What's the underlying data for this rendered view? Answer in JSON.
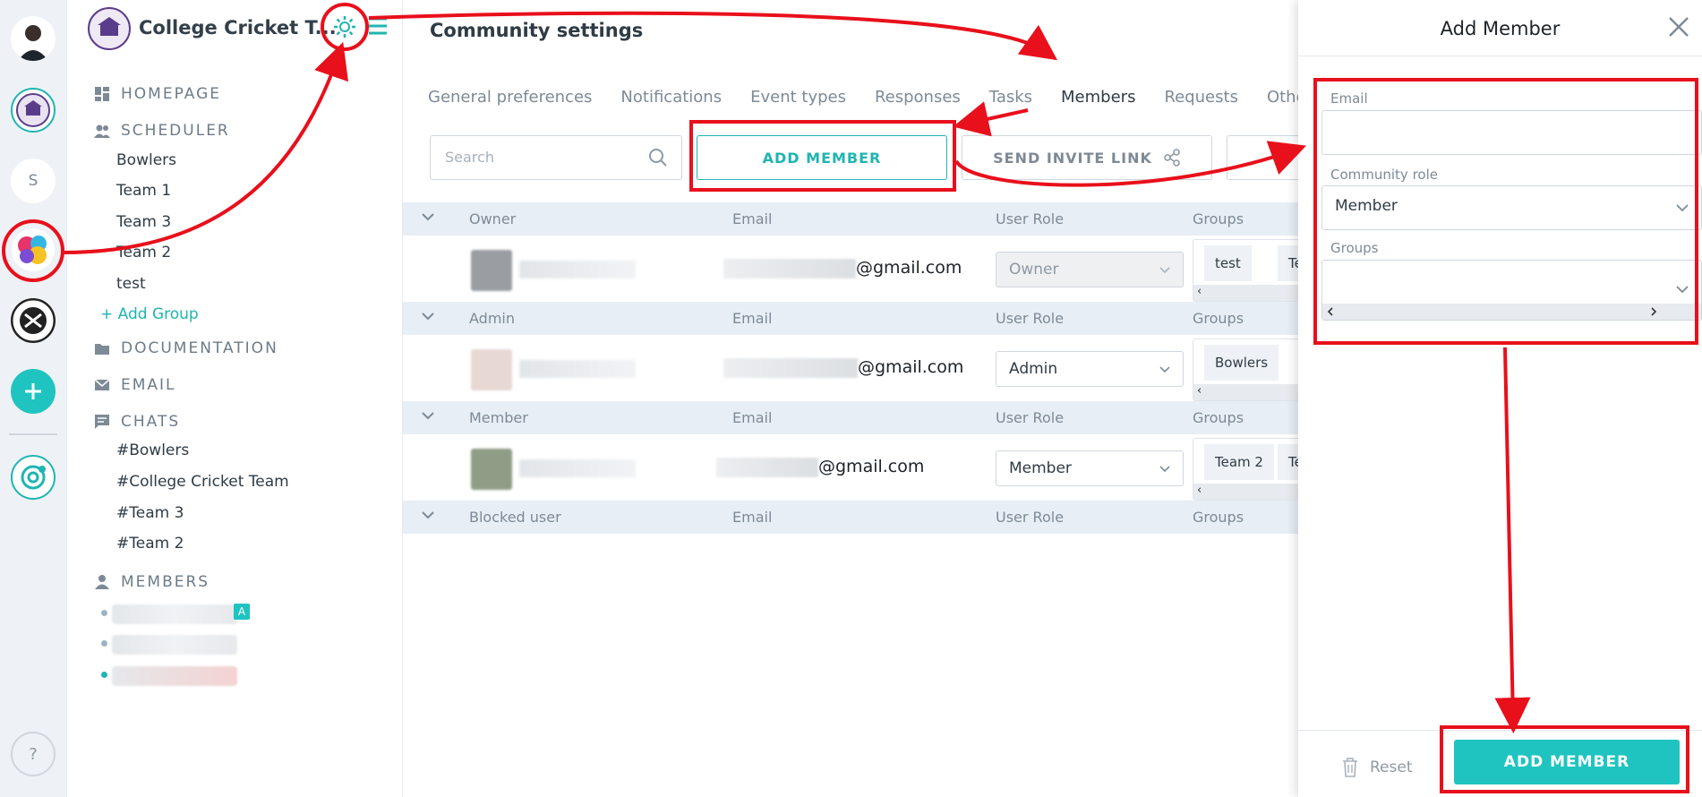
{
  "rail": {
    "items": [
      {
        "name": "user-avatar",
        "initial": ""
      },
      {
        "name": "university-community",
        "initial": ""
      },
      {
        "name": "community-s",
        "initial": "S"
      },
      {
        "name": "colorful-community",
        "initial": ""
      },
      {
        "name": "mining-community",
        "initial": ""
      }
    ],
    "help_label": "?"
  },
  "sidebar": {
    "title": "College Cricket T...",
    "sections": {
      "homepage": "HOMEPAGE",
      "scheduler": "SCHEDULER",
      "documentation": "DOCUMENTATION",
      "email": "EMAIL",
      "chats": "CHATS",
      "members": "MEMBERS"
    },
    "scheduler_items": [
      "Bowlers",
      "Team 1",
      "Team 3",
      "Team 2",
      "test"
    ],
    "add_group": "+ Add Group",
    "chat_items": [
      "#Bowlers",
      "#College Cricket Team",
      "#Team 3",
      "#Team 2"
    ],
    "admin_badge": "A"
  },
  "main": {
    "title": "Community settings",
    "tabs": [
      "General preferences",
      "Notifications",
      "Event types",
      "Responses",
      "Tasks",
      "Members",
      "Requests",
      "Other"
    ],
    "active_tab": "Members",
    "search_placeholder": "Search",
    "add_member_label": "ADD MEMBER",
    "send_invite_label": "SEND INVITE LINK",
    "columns": {
      "email": "Email",
      "user_role": "User Role",
      "groups": "Groups"
    },
    "sections": [
      {
        "header": "Owner",
        "email_suffix": "@gmail.com",
        "role": "Owner",
        "groups": [
          "test",
          "Te"
        ]
      },
      {
        "header": "Admin",
        "email_suffix": "@gmail.com",
        "role": "Admin",
        "groups": [
          "Bowlers"
        ]
      },
      {
        "header": "Member",
        "email_suffix": "@gmail.com",
        "role": "Member",
        "groups": [
          "Team 2",
          "Te"
        ]
      },
      {
        "header": "Blocked user"
      }
    ],
    "owner_email_prefix": ")"
  },
  "drawer": {
    "title": "Add Member",
    "email_label": "Email",
    "role_label": "Community role",
    "role_value": "Member",
    "groups_label": "Groups",
    "reset_label": "Reset",
    "submit_label": "ADD MEMBER"
  },
  "colors": {
    "accent": "#1fb5b2",
    "annotation": "#e8101b"
  }
}
